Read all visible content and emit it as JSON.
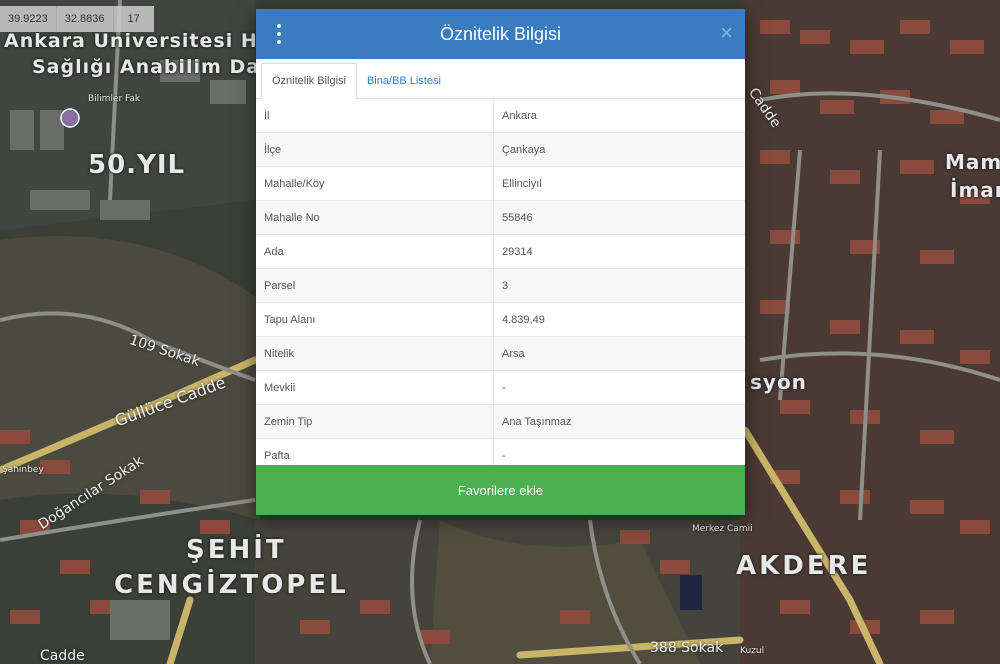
{
  "coords": {
    "lat": "39.9223",
    "lon": "32.8836",
    "zoom": "17"
  },
  "map": {
    "labels": {
      "university_line1": "Ankara Universitesi Ha",
      "university_line2": "Sağlığı Anabilim Dalı",
      "fifty_yil": "50.YIL",
      "sehit": "ŞEHİT",
      "cengiztopel": "CENGİZTOPEL",
      "akdere": "AKDERE",
      "mamak": "Mamak",
      "imam": "İmam",
      "yon": "syon"
    },
    "roads": {
      "sokak_109": "109 Sokak",
      "gullice": "Güllüce Cadde",
      "dogancilar": "Doğancılar Sokak",
      "sokak_388": "388 Sokak",
      "cadde_bottom": "Cadde",
      "cadde_right": "Cadde"
    },
    "small": {
      "bilimler": "Bilimler Fak",
      "merkez_camii": "Merkez Camii",
      "sahinbey": "Şahinbey",
      "bank": "Kuzul"
    }
  },
  "modal": {
    "title": "Öznitelik Bilgisi",
    "close": "×",
    "tabs": [
      "Öznitelik Bilgisi",
      "Bina/BB Listesi"
    ],
    "rows": [
      {
        "key": "İl",
        "value": "Ankara"
      },
      {
        "key": "İlçe",
        "value": "Çankaya"
      },
      {
        "key": "Mahalle/Köy",
        "value": "Ellinciyıl"
      },
      {
        "key": "Mahalle No",
        "value": "55846"
      },
      {
        "key": "Ada",
        "value": "29314"
      },
      {
        "key": "Parsel",
        "value": "3"
      },
      {
        "key": "Tapu Alanı",
        "value": "4.839,49"
      },
      {
        "key": "Nitelik",
        "value": "Arsa"
      },
      {
        "key": "Mevkii",
        "value": "-"
      },
      {
        "key": "Zemin Tip",
        "value": "Ana Taşınmaz"
      },
      {
        "key": "Pafta",
        "value": "-"
      }
    ],
    "favorite_button": "Favorilere ekle"
  },
  "colors": {
    "header": "#3a7cc1",
    "button": "#4caf50",
    "roads": "#c9b56a",
    "roofs": "#8a4a3c"
  }
}
